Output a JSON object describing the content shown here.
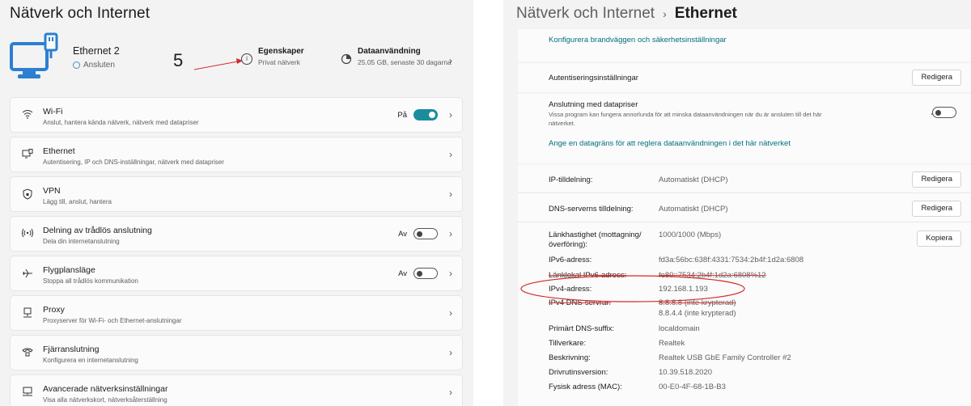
{
  "left": {
    "title": "Nätverk och Internet",
    "connection": {
      "name": "Ethernet 2",
      "status": "Ansluten"
    },
    "annotation_number": "5",
    "properties": {
      "title": "Egenskaper",
      "subtitle": "Privat nätverk",
      "icon": "info-icon"
    },
    "data_usage": {
      "title": "Dataanvändning",
      "subtitle": "25.05 GB, senaste 30 dagarna",
      "icon": "data-usage-icon"
    },
    "items": [
      {
        "title": "Wi-Fi",
        "subtitle": "Anslut, hantera kända nätverk, nätverk med datapriser",
        "state": "På",
        "toggle": "on",
        "icon": "wifi-icon"
      },
      {
        "title": "Ethernet",
        "subtitle": "Autentisering, IP och DNS-inställningar, nätverk med datapriser",
        "state": "",
        "toggle": "none",
        "icon": "ethernet-icon"
      },
      {
        "title": "VPN",
        "subtitle": "Lägg till, anslut, hantera",
        "state": "",
        "toggle": "none",
        "icon": "shield-icon"
      },
      {
        "title": "Delning av trådlös anslutning",
        "subtitle": "Dela din internetanslutning",
        "state": "Av",
        "toggle": "off",
        "icon": "hotspot-icon"
      },
      {
        "title": "Flygplansläge",
        "subtitle": "Stoppa all trådlös kommunikation",
        "state": "Av",
        "toggle": "off",
        "icon": "airplane-icon"
      },
      {
        "title": "Proxy",
        "subtitle": "Proxyserver för Wi-Fi- och Ethernet-anslutningar",
        "state": "",
        "toggle": "none",
        "icon": "proxy-icon"
      },
      {
        "title": "Fjärranslutning",
        "subtitle": "Konfigurera en internetanslutning",
        "state": "",
        "toggle": "none",
        "icon": "dialup-icon"
      },
      {
        "title": "Avancerade nätverksinställningar",
        "subtitle": "Visa alla nätverkskort, nätverksåterställning",
        "state": "",
        "toggle": "none",
        "icon": "advanced-network-icon"
      }
    ]
  },
  "right": {
    "breadcrumb_parent": "Nätverk och Internet",
    "breadcrumb_sep": "›",
    "breadcrumb_current": "Ethernet",
    "firewall_link": "Konfigurera brandväggen och säkerhetsinställningar",
    "auth_label": "Autentiseringsinställningar",
    "edit_label": "Redigera",
    "metered_title": "Anslutning med datapriser",
    "metered_desc_1": "Vissa program kan fungera annorlunda för att minska dataanvändningen när du är ansluten till det här",
    "metered_desc_2": "nätverket.",
    "metered_state": "Av",
    "data_limit_link": "Ange en datagräns för att reglera dataanvändningen i det här nätverket",
    "ip_assign_label": "IP-tilldelning:",
    "ip_assign_value": "Automatiskt (DHCP)",
    "dns_assign_label": "DNS-serverns tilldelning:",
    "dns_assign_value": "Automatiskt (DHCP)",
    "copy_label": "Kopiera",
    "details": {
      "link_speed_label_1": "Länkhastighet (mottagning/",
      "link_speed_label_2": "överföring):",
      "link_speed_value": "1000/1000 (Mbps)",
      "ipv6_label": "IPv6-adress:",
      "ipv6_value": "fd3a:56bc:638f:4331:7534:2b4f:1d2a:6808",
      "linklocal_label": "Länklokal IPv6-adress:",
      "linklocal_value": "fe80::7534:2b4f:1d2a:6808%12",
      "ipv4_label": "IPv4-adress:",
      "ipv4_value": "192.168.1.193",
      "dns_label": "IPv4 DNS-servrar:",
      "dns_value_1": "8.8.8.8 (inte krypterad)",
      "dns_value_2": "8.8.4.4 (inte krypterad)",
      "suffix_label": "Primärt DNS-suffix:",
      "suffix_value": "localdomain",
      "manufacturer_label": "Tillverkare:",
      "manufacturer_value": "Realtek",
      "description_label": "Beskrivning:",
      "description_value": "Realtek USB GbE Family Controller #2",
      "driver_label": "Drivrutinsversion:",
      "driver_value": "10.39.518.2020",
      "mac_label": "Fysisk adress (MAC):",
      "mac_value": "00-E0-4F-68-1B-B3"
    }
  },
  "colors": {
    "accent": "#1a8c9e",
    "link": "#00707f",
    "annotation": "#d42a2a",
    "hero_icon": "#2c7fd1"
  }
}
